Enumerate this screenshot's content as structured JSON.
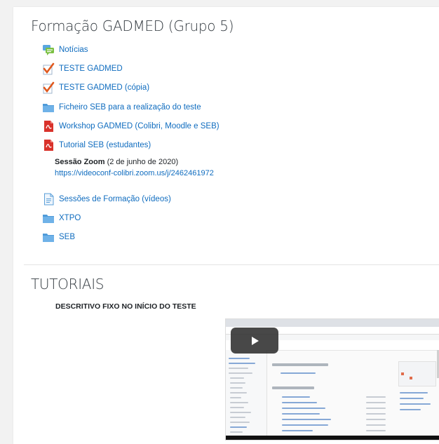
{
  "section1": {
    "title": "Formação GADMED (Grupo 5)",
    "activities": [
      {
        "label": "Notícias",
        "icon": "forum-icon"
      },
      {
        "label": "TESTE GADMED",
        "icon": "quiz-icon"
      },
      {
        "label": "TESTE GADMED (cópia)",
        "icon": "quiz-icon"
      },
      {
        "label": "Ficheiro SEB para a realização do teste",
        "icon": "folder-icon"
      },
      {
        "label": "Workshop GADMED (Colibri, Moodle e SEB)",
        "icon": "pdf-icon"
      },
      {
        "label": "Tutorial SEB (estudantes)",
        "icon": "pdf-icon"
      }
    ],
    "zoom_label": {
      "bold": "Sessão Zoom",
      "rest": " (2 de junho de 2020)",
      "link": "https://videoconf-colibri.zoom.us/j/2462461972"
    },
    "activities2": [
      {
        "label": "Sessões de Formação (vídeos)",
        "icon": "page-icon"
      },
      {
        "label": "XTPO",
        "icon": "folder-icon"
      },
      {
        "label": "SEB",
        "icon": "folder-icon"
      }
    ]
  },
  "section2": {
    "title": "TUTORIAIS",
    "subtitle": "DESCRITIVO FIXO NO INÍCIO DO TESTE",
    "video_icon": "play-icon"
  },
  "colors": {
    "link": "#0f6cbf",
    "title": "#333a40",
    "folder": "#4f9bd9",
    "pdf": "#d9322b",
    "quiz_check": "#e0581d"
  }
}
